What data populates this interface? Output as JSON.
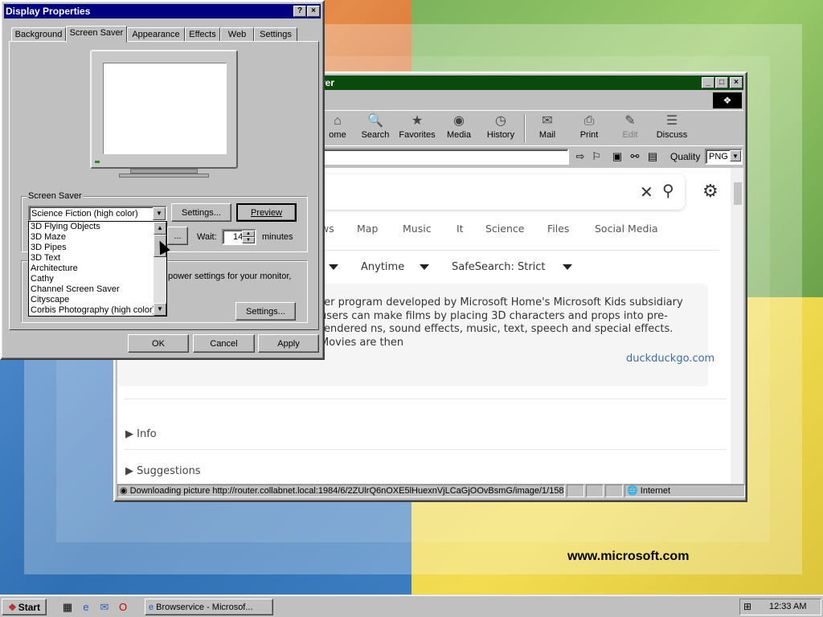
{
  "wallpaper": {
    "url_text": "www.microsoft.com"
  },
  "browser": {
    "title": "rer",
    "toolbar": [
      {
        "label": "ome",
        "icon": "home-icon",
        "glyph": "⌂"
      },
      {
        "label": "Search",
        "icon": "search-icon",
        "glyph": "🔍"
      },
      {
        "label": "Favorites",
        "icon": "favorites-icon",
        "glyph": "★"
      },
      {
        "label": "Media",
        "icon": "media-icon",
        "glyph": "◉"
      },
      {
        "label": "History",
        "icon": "history-icon",
        "glyph": "◷"
      },
      {
        "label": "Mail",
        "icon": "mail-icon",
        "glyph": "✉"
      },
      {
        "label": "Print",
        "icon": "print-icon",
        "glyph": "⎙"
      },
      {
        "label": "Edit",
        "icon": "edit-icon",
        "glyph": "✎"
      },
      {
        "label": "Discuss",
        "icon": "discuss-icon",
        "glyph": "☰"
      }
    ],
    "address_value": "rch",
    "quality_label": "Quality",
    "quality_value": "PNG",
    "nav_tabs": [
      "ws",
      "Map",
      "Music",
      "It",
      "Science",
      "Files",
      "Social Media"
    ],
    "filters": [
      "Anytime",
      "SafeSearch: Strict"
    ],
    "result_text": "ter program developed by Microsoft Home's Microsoft Kids subsidiary users can make films by placing 3D characters and props into pre-rendered ns, sound effects, music, text, speech and special effects. Movies are then",
    "result_source": "duckduckgo.com",
    "sections": [
      "Info",
      "Suggestions"
    ],
    "status_text": "Downloading picture http://router.collabnet.local:1984/6/2ZUlrQ6nOXE5lHuexnVjLCaGjOOvBsmG/image/1/1580",
    "status_zone": "Internet"
  },
  "dialog": {
    "title": "Display Properties",
    "tabs": [
      "Background",
      "Screen Saver",
      "Appearance",
      "Effects",
      "Web",
      "Settings"
    ],
    "active_tab": "Screen Saver",
    "group_label": "Screen Saver",
    "selected_saver": "Science Fiction (high color)",
    "saver_options": [
      "3D Flying Objects",
      "3D Maze",
      "3D Pipes",
      "3D Text",
      "Architecture",
      "Cathy",
      "Channel Screen Saver",
      "Cityscape",
      "Corbis Photography (high color)"
    ],
    "settings_btn": "Settings...",
    "preview_btn": "Preview",
    "wait_label": "Wait:",
    "wait_value": "14",
    "minutes_label": "minutes",
    "power_text": "power settings for your monitor,",
    "power_settings_btn": "Settings...",
    "ok_btn": "OK",
    "cancel_btn": "Cancel",
    "apply_btn": "Apply"
  },
  "taskbar": {
    "start_label": "Start",
    "task_label": "Browservice - Microsof...",
    "clock": "12:33 AM"
  }
}
